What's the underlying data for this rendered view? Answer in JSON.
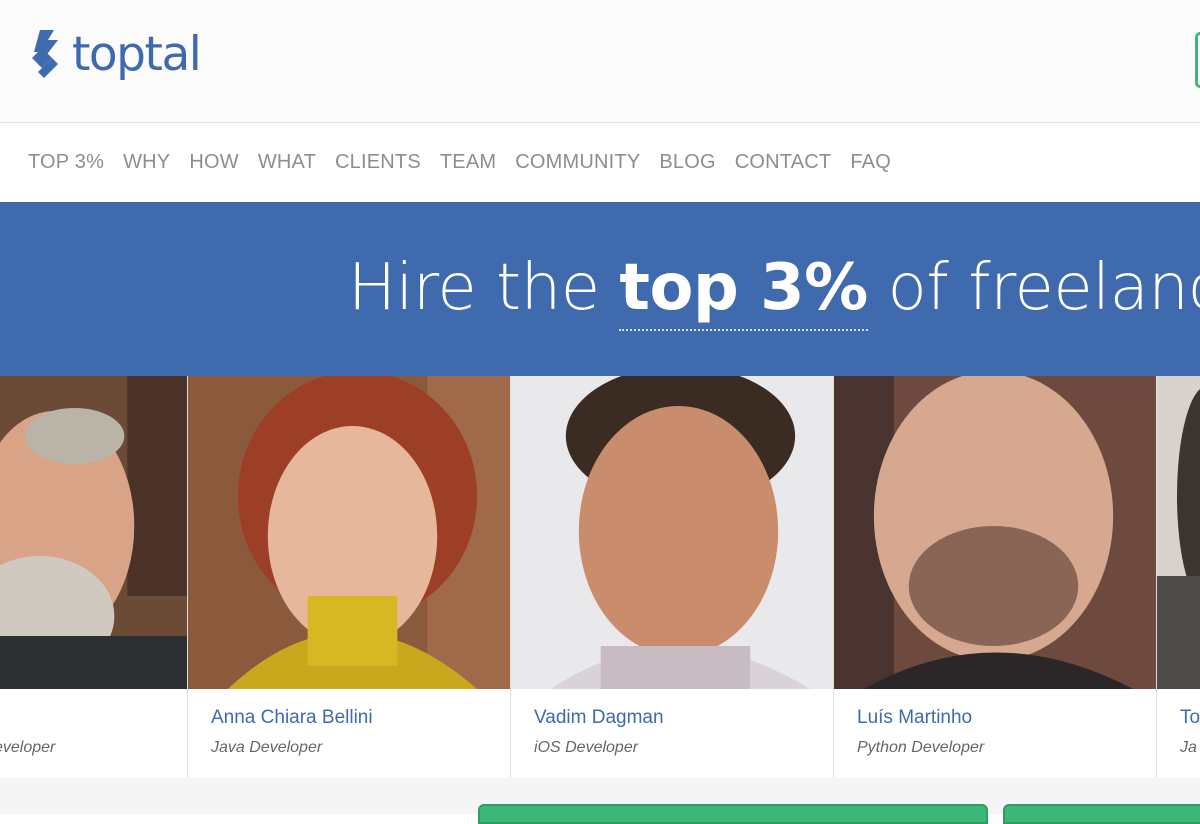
{
  "brand": {
    "name": "toptal"
  },
  "nav": {
    "items": [
      "TOP 3%",
      "WHY",
      "HOW",
      "WHAT",
      "CLIENTS",
      "TEAM",
      "COMMUNITY",
      "BLOG",
      "CONTACT",
      "FAQ"
    ]
  },
  "hero": {
    "title_prefix": "Hire the ",
    "title_bold": "top 3%",
    "title_suffix": " of freelanc"
  },
  "developers": [
    {
      "name": "",
      "role": "eveloper"
    },
    {
      "name": "Anna Chiara Bellini",
      "role": "Java Developer"
    },
    {
      "name": "Vadim Dagman",
      "role": "iOS Developer"
    },
    {
      "name": "Luís Martinho",
      "role": "Python Developer"
    },
    {
      "name": "To",
      "role": "Ja"
    }
  ],
  "colors": {
    "brand_blue": "#3f6aad",
    "cta_green": "#3cb878",
    "nav_text": "#8e8e8e"
  }
}
